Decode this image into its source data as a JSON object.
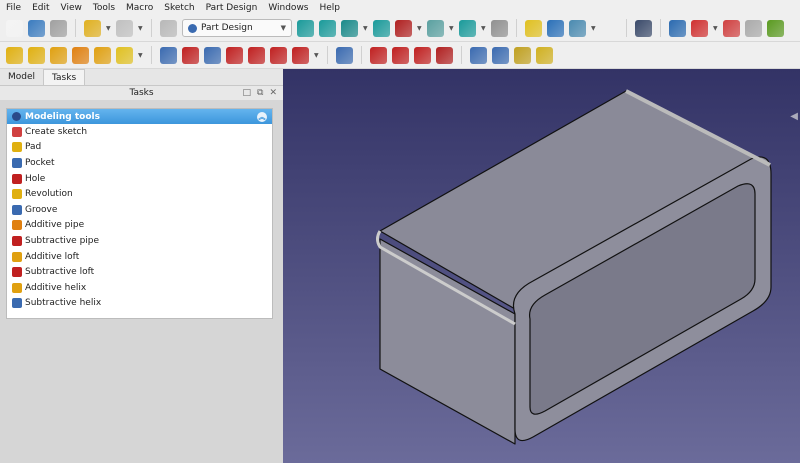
{
  "menu": [
    "File",
    "Edit",
    "View",
    "Tools",
    "Macro",
    "Sketch",
    "Part Design",
    "Windows",
    "Help"
  ],
  "toolbar1": {
    "left_icons": [
      {
        "n": "new-file-icon",
        "c": "#f4f4f4"
      },
      {
        "n": "open-file-icon",
        "c": "#3a7bbf"
      },
      {
        "n": "save-icon",
        "c": "#a0a0a0"
      },
      {
        "n": "sep"
      },
      {
        "n": "undo-icon",
        "c": "#e0b020",
        "dd": 1
      },
      {
        "n": "redo-icon",
        "c": "#c0c0c0",
        "dd": 1
      },
      {
        "n": "sep"
      },
      {
        "n": "refresh-icon",
        "c": "#b8b8b8"
      }
    ],
    "workbench": "Part Design",
    "right_icons": [
      {
        "n": "zoom-fit-all-icon",
        "c": "#1a9a9a"
      },
      {
        "n": "zoom-fit-selection-icon",
        "c": "#1a9a9a"
      },
      {
        "n": "isometric-view-icon",
        "c": "#1a8a8a",
        "dd": 1
      },
      {
        "n": "front-view-icon",
        "c": "#1a9a9a"
      },
      {
        "n": "draw-style-icon",
        "c": "#b02020",
        "dd": 1
      },
      {
        "n": "standard-views-icon",
        "c": "#5aa0a0",
        "dd": 1
      },
      {
        "n": "zoom-icon",
        "c": "#1a9a9a",
        "dd": 1
      },
      {
        "n": "measure-icon",
        "c": "#909090"
      },
      {
        "n": "sep"
      },
      {
        "n": "part-icon",
        "c": "#e0c020"
      },
      {
        "n": "group-icon",
        "c": "#2a70b8"
      },
      {
        "n": "link-icon",
        "c": "#4a8ab0",
        "dd": 1
      },
      {
        "n": "variable-set-icon",
        "c": "#555"
      },
      {
        "n": "sep"
      },
      {
        "n": "whats-this-icon",
        "c": "#3a4a6a"
      },
      {
        "n": "sep"
      },
      {
        "n": "body-icon",
        "c": "#2a6ab0"
      },
      {
        "n": "sketch-icon",
        "c": "#d03030",
        "dd": 1
      },
      {
        "n": "validate-sketch-icon",
        "c": "#d04040"
      },
      {
        "n": "shape-binder-icon",
        "c": "#aaaaaa"
      },
      {
        "n": "clone-icon",
        "c": "#5a9a20"
      }
    ]
  },
  "toolbar2": [
    {
      "n": "pad-icon",
      "c": "#e0b010"
    },
    {
      "n": "revolution-icon",
      "c": "#e0b010"
    },
    {
      "n": "additive-loft-icon",
      "c": "#e0a010"
    },
    {
      "n": "additive-pipe-icon",
      "c": "#e08010"
    },
    {
      "n": "additive-helix-icon",
      "c": "#e0a010"
    },
    {
      "n": "additive-primitive-icon",
      "c": "#e0c020",
      "dd": 1
    },
    {
      "n": "sep"
    },
    {
      "n": "pocket-icon",
      "c": "#3a6ab0"
    },
    {
      "n": "hole-icon",
      "c": "#c02020"
    },
    {
      "n": "groove-icon",
      "c": "#3a6ab0"
    },
    {
      "n": "subtractive-loft-icon",
      "c": "#c02020"
    },
    {
      "n": "subtractive-pipe-icon",
      "c": "#c02020"
    },
    {
      "n": "subtractive-helix-icon",
      "c": "#c02020"
    },
    {
      "n": "subtractive-primitive-icon",
      "c": "#c02020",
      "dd": 1
    },
    {
      "n": "sep"
    },
    {
      "n": "boolean-icon",
      "c": "#3a6ab0"
    },
    {
      "n": "sep"
    },
    {
      "n": "fillet-icon",
      "c": "#c02020"
    },
    {
      "n": "chamfer-icon",
      "c": "#c02020"
    },
    {
      "n": "draft-icon",
      "c": "#c02020"
    },
    {
      "n": "thickness-icon",
      "c": "#b02020"
    },
    {
      "n": "sep"
    },
    {
      "n": "mirrored-icon",
      "c": "#3a6ab0"
    },
    {
      "n": "linear-pattern-icon",
      "c": "#3a6ab0"
    },
    {
      "n": "polar-pattern-icon",
      "c": "#c0a020"
    },
    {
      "n": "multitransform-icon",
      "c": "#d0b020"
    }
  ],
  "tabs": [
    "Model",
    "Tasks"
  ],
  "task_header": "Tasks",
  "panel": {
    "title": "Modeling tools",
    "items": [
      {
        "label": "Create sketch",
        "icon": "create-sketch-icon",
        "c": "#d04040"
      },
      {
        "label": "Pad",
        "icon": "pad-icon",
        "c": "#e0b010"
      },
      {
        "label": "Pocket",
        "icon": "pocket-icon",
        "c": "#3a6ab0"
      },
      {
        "label": "Hole",
        "icon": "hole-icon",
        "c": "#c02020"
      },
      {
        "label": "Revolution",
        "icon": "revolution-icon",
        "c": "#e0b010"
      },
      {
        "label": "Groove",
        "icon": "groove-icon",
        "c": "#3a6ab0"
      },
      {
        "label": "Additive pipe",
        "icon": "additive-pipe-icon",
        "c": "#e08010"
      },
      {
        "label": "Subtractive pipe",
        "icon": "subtractive-pipe-icon",
        "c": "#c02020"
      },
      {
        "label": "Additive loft",
        "icon": "additive-loft-icon",
        "c": "#e0a010"
      },
      {
        "label": "Subtractive loft",
        "icon": "subtractive-loft-icon",
        "c": "#c02020"
      },
      {
        "label": "Additive helix",
        "icon": "additive-helix-icon",
        "c": "#e0a010"
      },
      {
        "label": "Subtractive helix",
        "icon": "subtractive-helix-icon",
        "c": "#3a6ab0"
      }
    ]
  }
}
